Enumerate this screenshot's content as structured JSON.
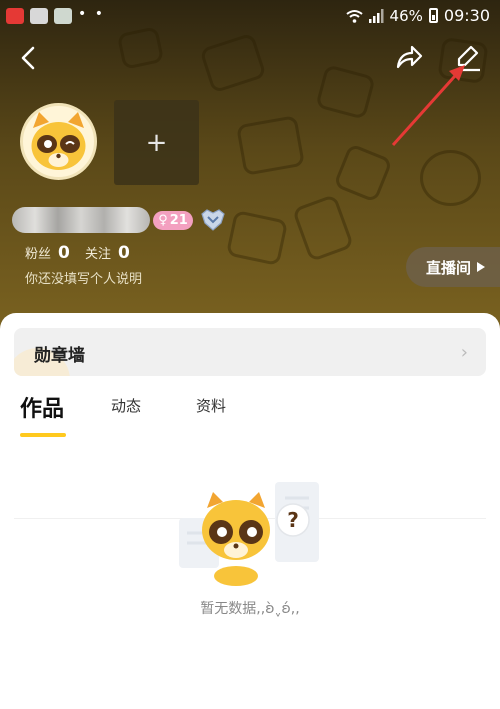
{
  "status_bar": {
    "battery": "46%",
    "time": "09:30",
    "dots": "• •"
  },
  "profile": {
    "add_icon": "+",
    "gender_badge": {
      "symbol": "♀",
      "age": "21"
    },
    "stats": {
      "fans_label": "粉丝",
      "fans_value": "0",
      "following_label": "关注",
      "following_value": "0"
    },
    "bio": "你还没填写个人说明",
    "live_button": "直播间"
  },
  "medal_wall": {
    "label": "勋章墙"
  },
  "tabs": [
    {
      "label": "作品"
    },
    {
      "label": "动态"
    },
    {
      "label": "资料"
    }
  ],
  "empty_state": {
    "text": "暂无数据,,ʚ̀ˬʚ́,,",
    "question_mark": "?"
  },
  "colors": {
    "accent": "#ffc91e",
    "header_bg": "#5a4818",
    "gender_badge": "#f3a0c0",
    "annotation_arrow": "#e53935"
  },
  "icons": [
    "back-arrow-icon",
    "share-icon",
    "edit-pencil-icon",
    "plus-icon",
    "rank-badge-icon",
    "play-triangle-icon",
    "chevron-right-icon",
    "wifi-icon",
    "signal-icon",
    "battery-icon"
  ]
}
